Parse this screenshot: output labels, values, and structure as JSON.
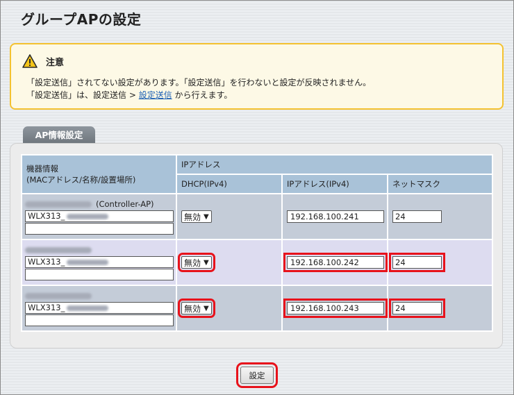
{
  "page": {
    "title": "グループAPの設定"
  },
  "notice": {
    "heading": "注意",
    "line1": "「設定送信」されてない設定があります。「設定送信」を行わないと設定が反映されません。",
    "line2_prefix": "「設定送信」は、設定送信 > ",
    "line2_link": "設定送信",
    "line2_suffix": " から行えます。",
    "icon": "warning-triangle-icon",
    "border_color": "#f4c230"
  },
  "section": {
    "tab_label": "AP情報設定"
  },
  "table": {
    "device_header_line1": "機器情報",
    "device_header_line2": "(MACアドレス/名称/設置場所)",
    "ip_group_header": "IPアドレス",
    "dhcp_header": "DHCP(IPv4)",
    "ip_header": "IPアドレス(IPv4)",
    "mask_header": "ネットマスク",
    "rows": [
      {
        "role": "(Controller-AP)",
        "name": "WLX313_",
        "location": "",
        "dhcp": "無効",
        "ip": "192.168.100.241",
        "mask": "24"
      },
      {
        "role": "",
        "name": "WLX313_",
        "location": "",
        "dhcp": "無効",
        "ip": "192.168.100.242",
        "mask": "24"
      },
      {
        "role": "",
        "name": "WLX313_",
        "location": "",
        "dhcp": "無効",
        "ip": "192.168.100.243",
        "mask": "24"
      }
    ]
  },
  "actions": {
    "set_label": "設定"
  },
  "colors": {
    "highlight": "#e8121b",
    "header": "#a9c2d8",
    "link": "#1a5fb4"
  }
}
